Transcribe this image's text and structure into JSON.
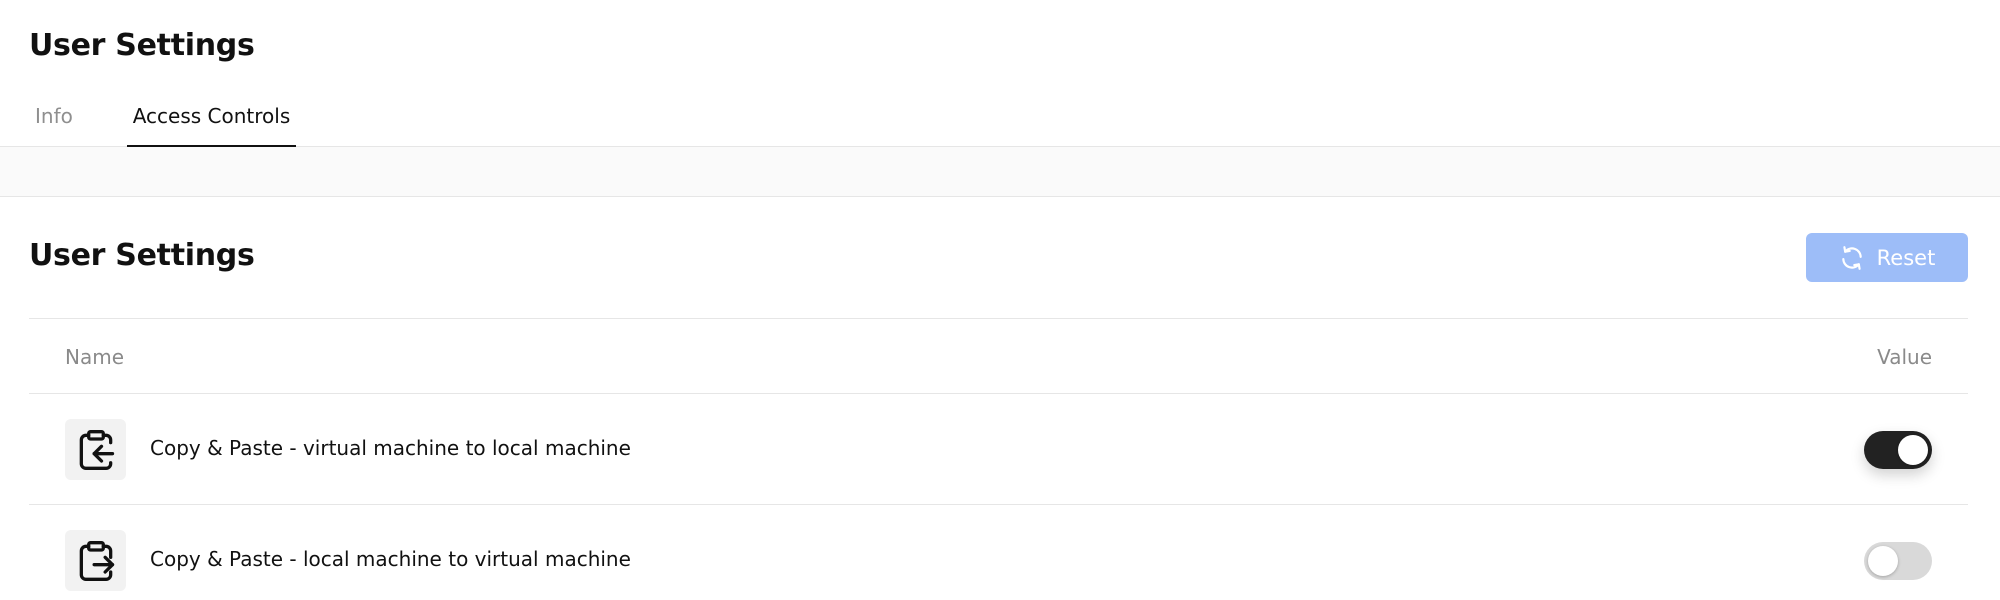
{
  "header": {
    "title": "User Settings"
  },
  "tabs": [
    {
      "label": "Info",
      "active": false
    },
    {
      "label": "Access Controls",
      "active": true
    }
  ],
  "section": {
    "title": "User Settings",
    "reset_label": "Reset",
    "reset_icon": "refresh-icon"
  },
  "table": {
    "columns": {
      "name": "Name",
      "value": "Value"
    },
    "rows": [
      {
        "icon": "clipboard-arrow-left-icon",
        "label": "Copy & Paste - virtual machine to local machine",
        "enabled": true
      },
      {
        "icon": "clipboard-arrow-right-icon",
        "label": "Copy & Paste - local machine to virtual machine",
        "enabled": false
      }
    ]
  },
  "colors": {
    "accent_button": "#9dbdf8",
    "toggle_on": "#222222",
    "toggle_off": "#d9d9d9"
  }
}
